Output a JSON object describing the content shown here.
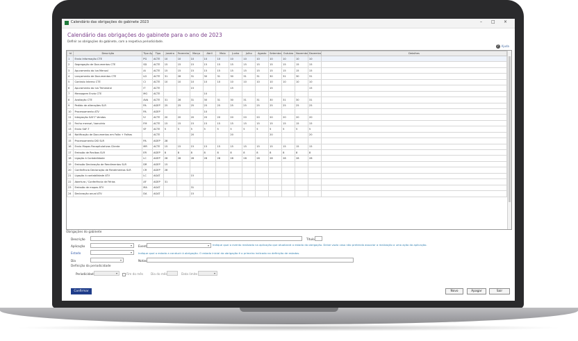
{
  "window": {
    "title": "Calendário das obrigações do gabinete 2023",
    "controls": [
      "–",
      "□",
      "×"
    ]
  },
  "page": {
    "title": "Calendário das obrigações do gabinete para o ano de 2023",
    "subtitle": "Definir as obrigações do gabinete, com a respetiva periodicidade.",
    "help": "Ajuda"
  },
  "table": {
    "columns": [
      "Id",
      "Descrição",
      "Tipo Aplic.",
      "Tipo",
      "Janeiro",
      "Fevereiro",
      "Março",
      "Abril",
      "Maio",
      "Junho",
      "Julho",
      "Agosto",
      "Setembro",
      "Outubro",
      "Novembro",
      "Dezembro",
      "Detalhes"
    ],
    "rows": [
      [
        "1",
        "Envio Informação CTE",
        "PG",
        "ACTE",
        "10",
        "10",
        "10",
        "10",
        "10",
        "10",
        "10",
        "10",
        "10",
        "10",
        "10",
        "10",
        ""
      ],
      [
        "2",
        "Segregação de Documentos CTE",
        "SD",
        "ACTE",
        "15",
        "15",
        "15",
        "15",
        "15",
        "15",
        "15",
        "15",
        "15",
        "15",
        "15",
        "15",
        ""
      ],
      [
        "3",
        "Apuramento do Iva Mensal",
        "AI",
        "ACTE",
        "15",
        "15",
        "15",
        "15",
        "15",
        "15",
        "15",
        "15",
        "15",
        "15",
        "15",
        "15",
        ""
      ],
      [
        "4",
        "Lançamento de Documentos CTE",
        "LD",
        "ACTE",
        "31",
        "28",
        "31",
        "30",
        "31",
        "30",
        "31",
        "31",
        "30",
        "31",
        "30",
        "31",
        ""
      ],
      [
        "5",
        "Controlo Interno CTE",
        "CI",
        "ACTE",
        "10",
        "10",
        "10",
        "10",
        "10",
        "10",
        "10",
        "10",
        "10",
        "10",
        "10",
        "10",
        ""
      ],
      [
        "6",
        "Apuramento do Iva Trimestral",
        "IT",
        "ACTE",
        "",
        "",
        "15",
        "",
        "",
        "15",
        "",
        "",
        "15",
        "",
        "",
        "15",
        ""
      ],
      [
        "7",
        "Mensagem Envio CTE",
        "MG",
        "ACTE",
        "",
        "",
        "",
        "10",
        "",
        "",
        "",
        "",
        "",
        "",
        "",
        "",
        ""
      ],
      [
        "8",
        "Avaliação CTE",
        "AVA",
        "ACTE",
        "31",
        "28",
        "31",
        "30",
        "31",
        "30",
        "31",
        "31",
        "30",
        "31",
        "30",
        "31",
        ""
      ],
      [
        "9",
        "Pedido de alterações SLR",
        "PA",
        "AGEP",
        "25",
        "25",
        "25",
        "25",
        "25",
        "25",
        "25",
        "25",
        "25",
        "25",
        "25",
        "25",
        ""
      ],
      [
        "10",
        "Processamento ATV",
        "PA",
        "AGEP",
        "",
        "",
        "",
        "10",
        "",
        "",
        "",
        "",
        "",
        "",
        "",
        "",
        ""
      ],
      [
        "11",
        "Integração SAF-T Vendas",
        "IV",
        "ACTE",
        "20",
        "20",
        "20",
        "20",
        "20",
        "20",
        "20",
        "20",
        "20",
        "20",
        "20",
        "20",
        ""
      ],
      [
        "12",
        "Fecho mensal / bancário",
        "FM",
        "ACTE",
        "15",
        "15",
        "15",
        "15",
        "15",
        "15",
        "15",
        "15",
        "15",
        "15",
        "15",
        "15",
        ""
      ],
      [
        "13",
        "Envio SAF-T",
        "SF",
        "ACTE",
        "5",
        "5",
        "5",
        "5",
        "5",
        "5",
        "5",
        "5",
        "5",
        "5",
        "5",
        "5",
        ""
      ],
      [
        "14",
        "Notificação de Documentos em Falta + Falhas",
        "",
        "ACTE",
        "",
        "",
        "20",
        "",
        "",
        "20",
        "",
        "",
        "20",
        "",
        "",
        "20",
        ""
      ],
      [
        "15",
        "Processamento DSI SLR",
        "PA",
        "AGEP",
        "28",
        "",
        "",
        "",
        "",
        "",
        "",
        "",
        "",
        "",
        "",
        "",
        ""
      ],
      [
        "16",
        "Envio Mapas Recapitulativos Cliente",
        "MR",
        "ACTE",
        "15",
        "15",
        "15",
        "15",
        "15",
        "15",
        "15",
        "15",
        "15",
        "15",
        "15",
        "15",
        ""
      ],
      [
        "17",
        "Emissão de Recibos SLR",
        "ER",
        "AGEP",
        "8",
        "8",
        "8",
        "8",
        "8",
        "8",
        "8",
        "8",
        "8",
        "8",
        "8",
        "8",
        ""
      ],
      [
        "18",
        "Ligação à Contabilidade",
        "LC",
        "AGEP",
        "28",
        "28",
        "28",
        "28",
        "28",
        "28",
        "28",
        "28",
        "28",
        "28",
        "28",
        "28",
        ""
      ],
      [
        "19",
        "Emissão Declaração de Rendimentos SLR",
        "DR",
        "AGEP",
        "15",
        "",
        "",
        "",
        "",
        "",
        "",
        "",
        "",
        "",
        "",
        "",
        ""
      ],
      [
        "20",
        "Conferência Declaração de Rendimentos SLR",
        "CR",
        "AGEP",
        "28",
        "",
        "",
        "",
        "",
        "",
        "",
        "",
        "",
        "",
        "",
        "",
        ""
      ],
      [
        "21",
        "Ligação à contabilidade ATV",
        "LC",
        "AGAT",
        "",
        "",
        "15",
        "",
        "",
        "",
        "",
        "",
        "",
        "",
        "",
        "",
        ""
      ],
      [
        "22",
        "Abertura / Conferência de Férias",
        "AF",
        "AGEP",
        "31",
        "",
        "",
        "",
        "",
        "",
        "",
        "",
        "",
        "",
        "",
        "",
        ""
      ],
      [
        "23",
        "Emissão de mapas ATV",
        "MA",
        "AGAT",
        "",
        "",
        "31",
        "",
        "",
        "",
        "",
        "",
        "",
        "",
        "",
        "",
        ""
      ],
      [
        "24",
        "Declaração anual ATV",
        "DA",
        "AGAT",
        "",
        "",
        "15",
        "",
        "",
        "",
        "",
        "",
        "",
        "",
        "",
        "",
        ""
      ]
    ]
  },
  "form": {
    "section_title": "Obrigações do gabinete",
    "descricao_label": "Descrição",
    "descricao_value": "",
    "titulo_label": "Título",
    "titulo_value": "",
    "aplicacao_label": "Aplicação",
    "aplicacao_value": "",
    "evento_label": "Evento",
    "evento_value": "",
    "evento_hint": "Indique qual o evento realizado na aplicação que atualizará o estado da obrigação. Deixe vazio caso não pretenda associar a realização a uma ação da aplicação.",
    "estado_label": "Estado",
    "estado_value": "",
    "estado_hint": "Indique qual o estado a conduzir à obrigação. O estado inicial da obrigação é o primeiro indicado na definição de estados.",
    "dia_label": "Dia",
    "dia_value": "",
    "notas_label": "Notas",
    "notas_value": "",
    "periodicidade_section": "Definição da periodicidade",
    "periodicidade_label": "Periodicidade",
    "fim_de_mes_label": "Fim do mês",
    "dia_do_mes_label": "Dia do mês",
    "data_limite_label": "Data limite"
  },
  "buttons": {
    "confirm": "Confirmar",
    "novo": "Novo",
    "apagar": "Apagar",
    "sair": "Sair"
  },
  "colors": {
    "title": "#7a3d8a",
    "primary_button": "#1f3d8a",
    "hint": "#2f7fb0",
    "frame": "#2a2a2c"
  }
}
